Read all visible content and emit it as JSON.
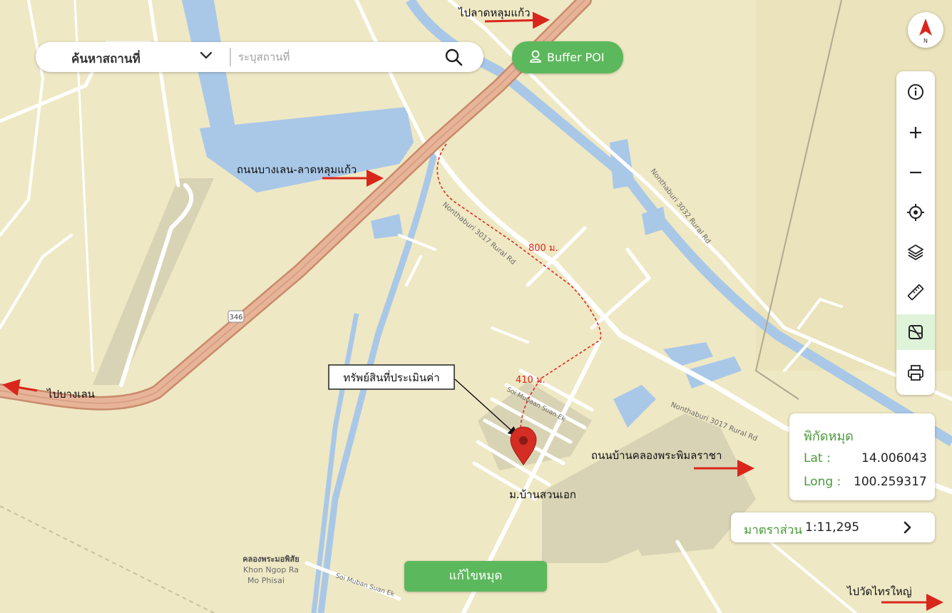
{
  "search": {
    "mode": "ค้นหาสถานที่",
    "placeholder": "ระบุสถานที่"
  },
  "buffer_button": {
    "label": "Buffer POI",
    "icon": "person-pin-icon"
  },
  "compass": {
    "label": "N",
    "icon": "compass-north-icon"
  },
  "toolbar": [
    {
      "name": "info",
      "icon": "info-icon"
    },
    {
      "name": "zoom-in",
      "icon": "plus-icon"
    },
    {
      "name": "zoom-out",
      "icon": "minus-icon"
    },
    {
      "name": "locate",
      "icon": "crosshair-icon"
    },
    {
      "name": "layers",
      "icon": "layers-icon"
    },
    {
      "name": "measure",
      "icon": "ruler-icon"
    },
    {
      "name": "basemap",
      "icon": "map-style-icon",
      "active": true
    },
    {
      "name": "print",
      "icon": "printer-icon"
    }
  ],
  "coordinates": {
    "title": "พิกัดหมุด",
    "lat_label": "Lat :",
    "lat_value": "14.006043",
    "long_label": "Long :",
    "long_value": "100.259317"
  },
  "scale": {
    "label": "มาตราส่วน",
    "value": "1:11,295"
  },
  "edit_button": {
    "label": "แก้ไขหมุด"
  },
  "annotations": {
    "to_lat_lum_kaeo": "ไปลาดหลุมแก้ว",
    "road_bang_len_lat_lum_kaeo": "ถนนบางเลน-ลาดหลุมแก้ว",
    "to_bang_len": "ไปบางเลน",
    "property_label": "ทรัพย์สินที่ประเมินค่า",
    "distance_800": "800 ม.",
    "distance_410": "410 ม.",
    "road_khlong_phra_phimon": "ถนนบ้านคลองพระพิมลราชา",
    "village": "ม.บ้านสวนเอก",
    "to_wat_sai_yai": "ไปวัดไทรใหญ่"
  },
  "map_labels": {
    "route_346": "346",
    "khlong_name_th": "คลองพระมอพิสัย",
    "khlong_name_en_1": "Khon Ngop Ra",
    "khlong_name_en_2": "Mo Phisai",
    "road_3017": "Nonthaburi 3017 Rural Rd",
    "road_3032": "Nonthaburi 3032 Rural Rd",
    "road_3017_b": "Nonthaburi 3017 Rural Rd",
    "soi_suan_ek": "Soi Mubaan Suan Ek",
    "soi_suan_ek_2": "Soi Muban Suan Ek"
  },
  "colors": {
    "land": "#efe8c4",
    "water": "#a9c8e8",
    "highway": "#e2a88a",
    "highway_edge": "#c98a6c",
    "road": "#ffffff",
    "built": "#d8d2b4",
    "accent_green": "#5cb85c",
    "arrow_red": "#d9261c",
    "pin_red": "#d42d23"
  }
}
